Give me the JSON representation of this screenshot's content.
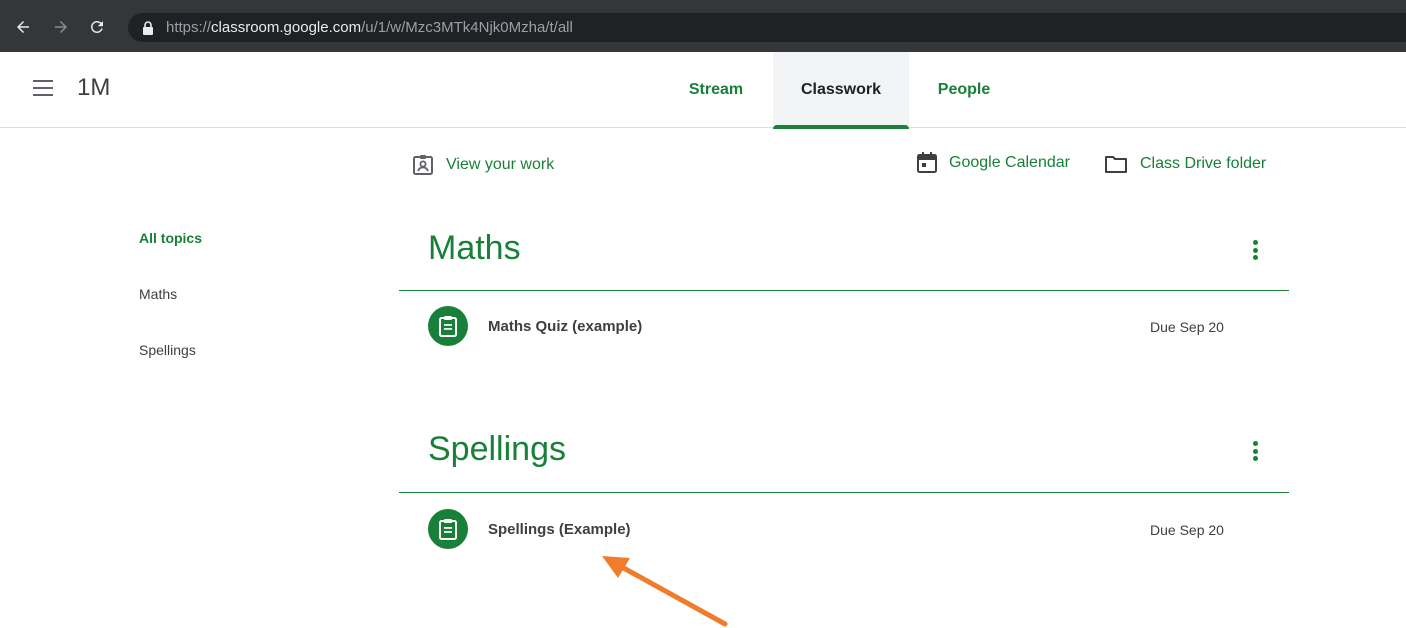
{
  "browser": {
    "url_scheme": "https://",
    "url_domain": "classroom.google.com",
    "url_path": "/u/1/w/Mzc3MTk4Njk0Mzha/t/all",
    "icons": [
      "back-icon",
      "forward-icon",
      "reload-icon",
      "lock-icon"
    ]
  },
  "header": {
    "class_name": "1M",
    "tabs": [
      {
        "label": "Stream"
      },
      {
        "label": "Classwork",
        "active": true
      },
      {
        "label": "People"
      }
    ]
  },
  "toolbar": {
    "view_work": "View your work",
    "calendar": "Google Calendar",
    "drive": "Class Drive folder"
  },
  "sidebar": {
    "items": [
      {
        "label": "All topics",
        "active": true
      },
      {
        "label": "Maths"
      },
      {
        "label": "Spellings"
      }
    ]
  },
  "topics": [
    {
      "title": "Maths",
      "assignments": [
        {
          "title": "Maths Quiz (example)",
          "due": "Due Sep 20",
          "icon": "assignment-icon"
        }
      ]
    },
    {
      "title": "Spellings",
      "assignments": [
        {
          "title": "Spellings (Example)",
          "due": "Due Sep 20",
          "icon": "assignment-icon"
        }
      ]
    }
  ],
  "colors": {
    "accent": "#188038",
    "annotation_arrow": "#ef7d2c",
    "browser_chrome": "#35363a"
  }
}
